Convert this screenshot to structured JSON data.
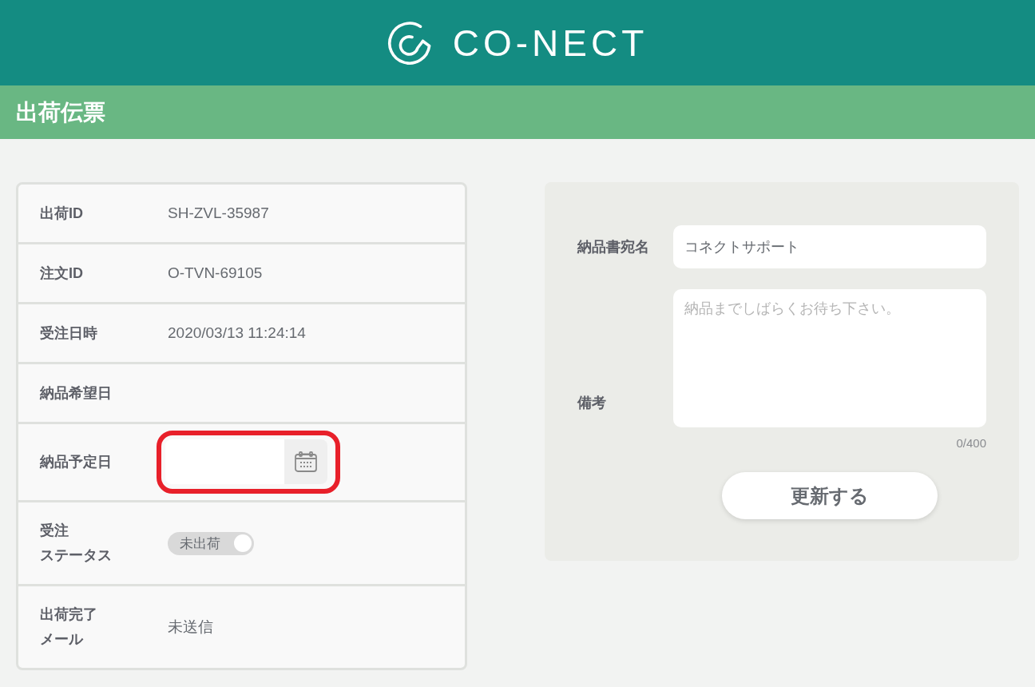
{
  "header": {
    "logo_text": "CO-NECT"
  },
  "title_bar": {
    "title": "出荷伝票"
  },
  "details": {
    "rows": [
      {
        "kind": "text",
        "label": "出荷ID",
        "value": "SH-ZVL-35987"
      },
      {
        "kind": "text",
        "label": "注文ID",
        "value": "O-TVN-69105"
      },
      {
        "kind": "text",
        "label": "受注日時",
        "value": "2020/03/13 11:24:14"
      },
      {
        "kind": "text",
        "label": "納品希望日"
      },
      {
        "kind": "date",
        "label": "納品予定日",
        "highlighted": true
      },
      {
        "kind": "toggle",
        "label": "受注ステータス",
        "toggle": {
          "label": "未出荷",
          "on": false
        }
      },
      {
        "kind": "text",
        "label": "出荷完了メール",
        "value": "未送信"
      }
    ]
  },
  "form": {
    "recipient": {
      "label": "納品書宛名",
      "value": "コネクトサポート"
    },
    "remarks": {
      "label": "備考",
      "placeholder": "納品までしばらくお待ち下さい。",
      "counter": "0/400"
    },
    "submit_button": "更新する"
  }
}
